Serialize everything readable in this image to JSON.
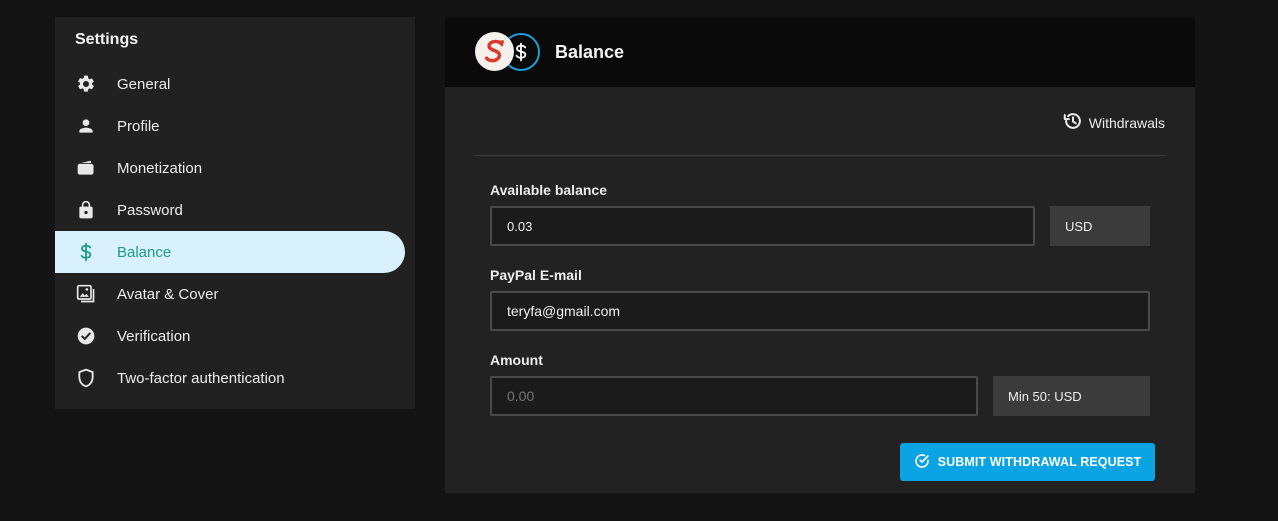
{
  "sidebar": {
    "title": "Settings",
    "items": [
      {
        "label": "General",
        "icon": "gear-icon"
      },
      {
        "label": "Profile",
        "icon": "person-icon"
      },
      {
        "label": "Monetization",
        "icon": "wallet-icon"
      },
      {
        "label": "Password",
        "icon": "lock-icon"
      },
      {
        "label": "Balance",
        "icon": "dollar-icon",
        "active": true
      },
      {
        "label": "Avatar & Cover",
        "icon": "images-icon"
      },
      {
        "label": "Verification",
        "icon": "check-circle-icon"
      },
      {
        "label": "Two-factor authentication",
        "icon": "shield-icon"
      }
    ]
  },
  "panel": {
    "title": "Balance",
    "withdrawals_label": "Withdrawals",
    "available_balance": {
      "label": "Available balance",
      "value": "0.03",
      "currency": "USD"
    },
    "paypal_email": {
      "label": "PayPal E-mail",
      "value": "teryfa@gmail.com"
    },
    "amount": {
      "label": "Amount",
      "placeholder": "0.00",
      "min_note": "Min 50: USD"
    },
    "submit_label": "SUBMIT WITHDRAWAL REQUEST"
  },
  "colors": {
    "accent": "#0aa3e4",
    "active_bg": "#d9f1fd",
    "active_text": "#1e9a86",
    "logo_red": "#d93a2f"
  }
}
